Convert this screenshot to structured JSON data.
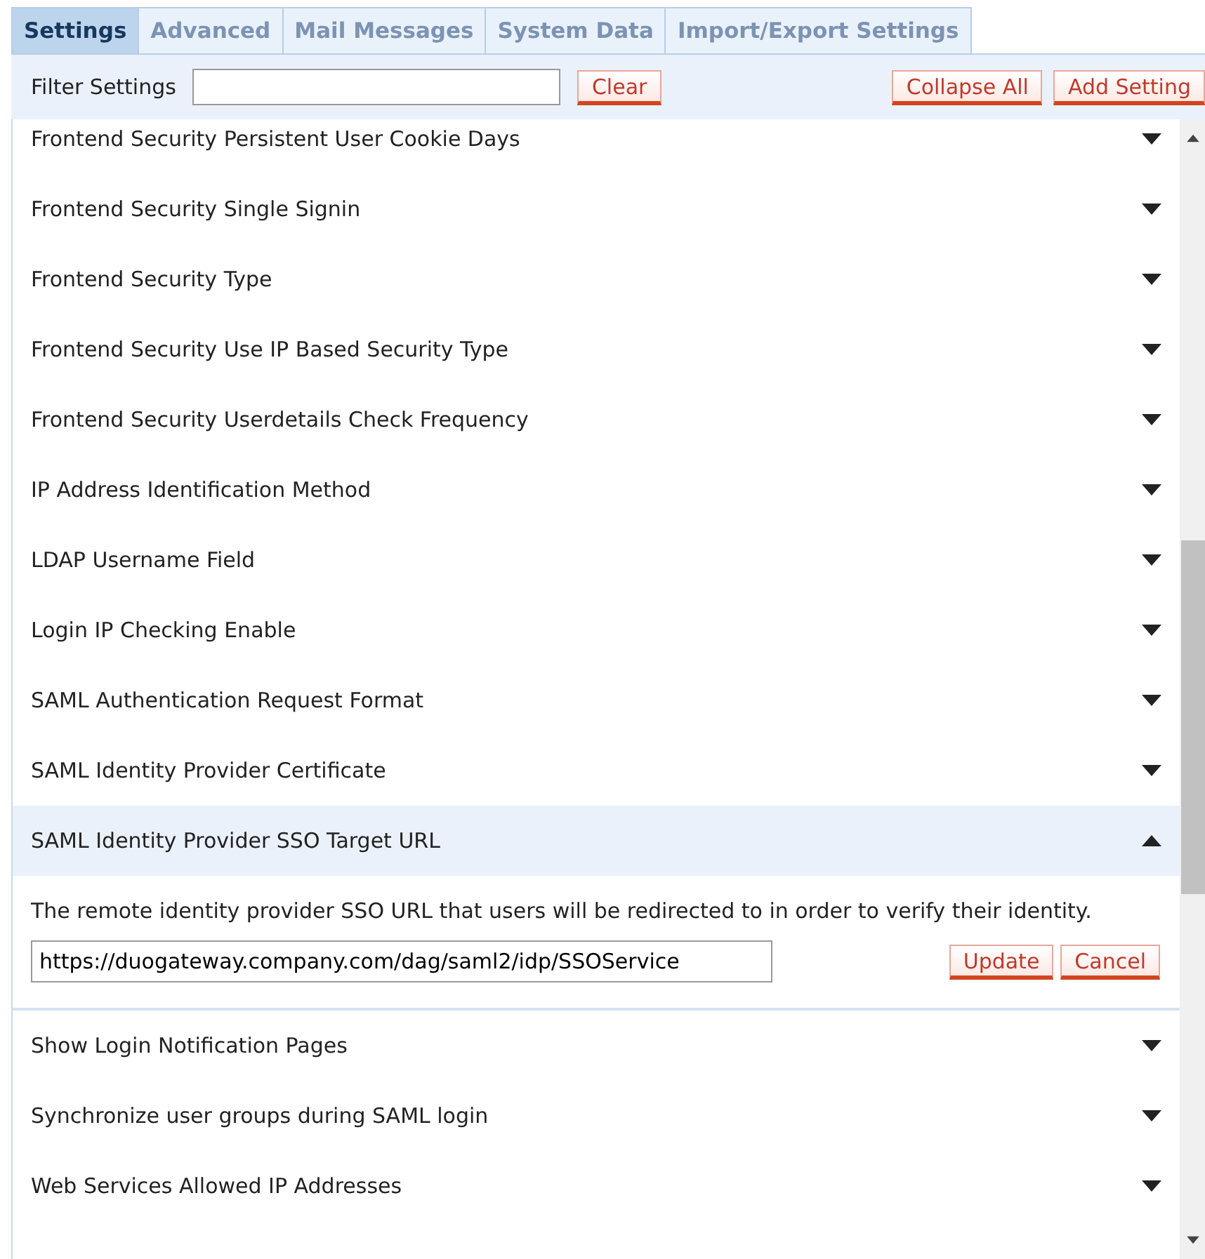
{
  "tabs": [
    {
      "label": "Settings",
      "selected": true
    },
    {
      "label": "Advanced",
      "selected": false
    },
    {
      "label": "Mail Messages",
      "selected": false
    },
    {
      "label": "System Data",
      "selected": false
    },
    {
      "label": "Import/Export Settings",
      "selected": false
    }
  ],
  "toolbar": {
    "filter_label": "Filter Settings",
    "clear_button": "Clear",
    "collapse_button": "Collapse All",
    "add_button": "Add Setting"
  },
  "settings": [
    {
      "name": "Frontend Security Persistent User Cookie Days",
      "expanded": false
    },
    {
      "name": "Frontend Security Single Signin",
      "expanded": false
    },
    {
      "name": "Frontend Security Type",
      "expanded": false
    },
    {
      "name": "Frontend Security Use IP Based Security Type",
      "expanded": false
    },
    {
      "name": "Frontend Security Userdetails Check Frequency",
      "expanded": false
    },
    {
      "name": "IP Address Identification Method",
      "expanded": false
    },
    {
      "name": "LDAP Username Field",
      "expanded": false
    },
    {
      "name": "Login IP Checking Enable",
      "expanded": false
    },
    {
      "name": "SAML Authentication Request Format",
      "expanded": false
    },
    {
      "name": "SAML Identity Provider Certificate",
      "expanded": false
    },
    {
      "name": "SAML Identity Provider SSO Target URL",
      "expanded": true,
      "description": "The remote identity provider SSO URL that users will be redirected to in order to verify their identity.",
      "value": "https://duogateway.company.com/dag/saml2/idp/SSOService",
      "update_button": "Update",
      "cancel_button": "Cancel"
    },
    {
      "name": "Show Login Notification Pages",
      "expanded": false
    },
    {
      "name": "Synchronize user groups during SAML login",
      "expanded": false
    },
    {
      "name": "Web Services Allowed IP Addresses",
      "expanded": false
    }
  ]
}
